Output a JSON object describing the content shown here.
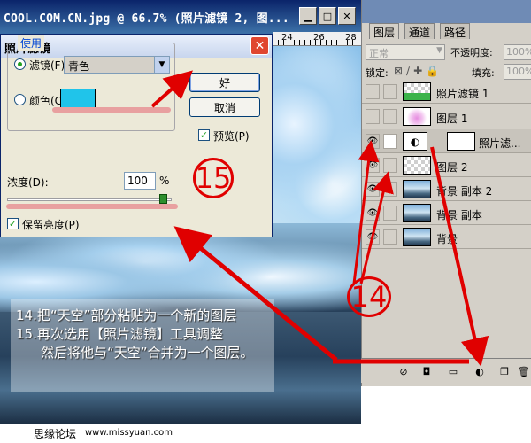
{
  "document_window": {
    "title": "COOL.COM.CN.jpg @ 66.7% (照片滤镜 2, 图...",
    "ruler_labels": [
      "24",
      "26",
      "28"
    ]
  },
  "photo_filter_dialog": {
    "title": "照片滤镜",
    "group_label": "使用",
    "filter_label": "滤镜(F):",
    "filter_value": "青色",
    "color_label": "颜色(C):",
    "swatch_color": "#20c4ea",
    "ok_label": "好",
    "cancel_label": "取消",
    "preview_label": "预览(P)",
    "density_label": "浓度(D):",
    "density_value": "100",
    "density_unit": "%",
    "density_slider_level_percent": 100,
    "preserve_label": "保留亮度(P)"
  },
  "annotations": {
    "step_15": "15",
    "step_14": "14",
    "instructions": [
      "14.把“天空”部分粘贴为一个新的图层",
      "15.再次选用【照片滤镜】工具调整",
      "然后将他与“天空”合并为一个图层。"
    ]
  },
  "layers_panel": {
    "tabs": [
      "图层",
      "通道",
      "路径"
    ],
    "blend_mode": "正常",
    "opacity_label": "不透明度:",
    "opacity_value": "100%",
    "lock_label": "锁定:",
    "fill_label": "填充:",
    "fill_value": "100%",
    "layers": [
      {
        "name": "照片滤镜 1",
        "visible": false,
        "thumb": "green"
      },
      {
        "name": "图层 1",
        "visible": false,
        "thumb": "pink"
      },
      {
        "name": "照片滤...",
        "visible": true,
        "thumb": "adjust"
      },
      {
        "name": "图层 2",
        "visible": true,
        "thumb": "checker"
      },
      {
        "name": "背景 副本 2",
        "visible": true,
        "thumb": "photo"
      },
      {
        "name": "背景 副本",
        "visible": true,
        "thumb": "photo"
      },
      {
        "name": "背景",
        "visible": true,
        "thumb": "photo"
      }
    ]
  },
  "footer": {
    "forum_name": "思缘论坛",
    "url": "www.missyuan.com"
  },
  "colors": {
    "arrow_red": "#e00000",
    "highlight_pink": "#e8a0a0"
  }
}
